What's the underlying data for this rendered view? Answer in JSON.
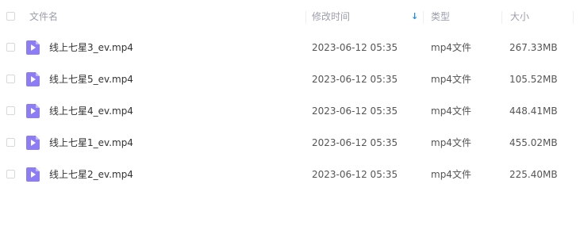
{
  "header": {
    "name_label": "文件名",
    "time_label": "修改时间",
    "sort_icon": "arrow-down-icon",
    "type_label": "类型",
    "size_label": "大小"
  },
  "colors": {
    "accent": "#1f8ded",
    "file_icon": "#8c7cf6",
    "header_text": "#9a9fab"
  },
  "files": [
    {
      "name": "线上七星3_ev.mp4",
      "modified": "2023-06-12 05:35",
      "type": "mp4文件",
      "size": "267.33MB",
      "icon": "video-file-icon"
    },
    {
      "name": "线上七星5_ev.mp4",
      "modified": "2023-06-12 05:35",
      "type": "mp4文件",
      "size": "105.52MB",
      "icon": "video-file-icon"
    },
    {
      "name": "线上七星4_ev.mp4",
      "modified": "2023-06-12 05:35",
      "type": "mp4文件",
      "size": "448.41MB",
      "icon": "video-file-icon"
    },
    {
      "name": "线上七星1_ev.mp4",
      "modified": "2023-06-12 05:35",
      "type": "mp4文件",
      "size": "455.02MB",
      "icon": "video-file-icon"
    },
    {
      "name": "线上七星2_ev.mp4",
      "modified": "2023-06-12 05:35",
      "type": "mp4文件",
      "size": "225.40MB",
      "icon": "video-file-icon"
    }
  ]
}
